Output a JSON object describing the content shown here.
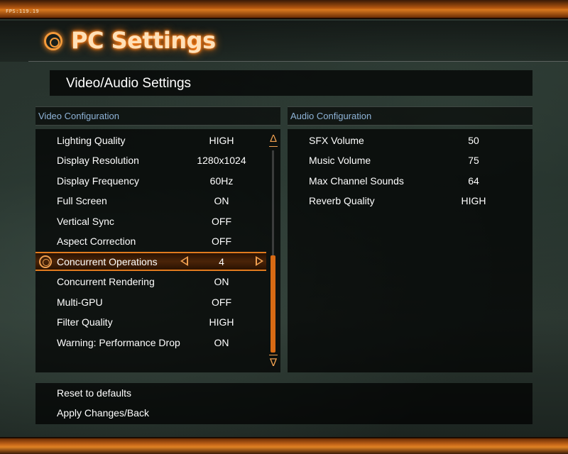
{
  "fps": "FPS:119.19",
  "app_title": "PC Settings",
  "panel_title": "Video/Audio Settings",
  "video": {
    "header": "Video Configuration",
    "rows": [
      {
        "label": "Lighting Quality",
        "value": "HIGH"
      },
      {
        "label": "Display Resolution",
        "value": "1280x1024"
      },
      {
        "label": "Display Frequency",
        "value": "60Hz"
      },
      {
        "label": "Full Screen",
        "value": "ON"
      },
      {
        "label": "Vertical Sync",
        "value": "OFF"
      },
      {
        "label": "Aspect Correction",
        "value": "OFF"
      },
      {
        "label": "Concurrent Operations",
        "value": "4"
      },
      {
        "label": "Concurrent Rendering",
        "value": "ON"
      },
      {
        "label": "Multi-GPU",
        "value": "OFF"
      },
      {
        "label": "Filter Quality",
        "value": "HIGH"
      },
      {
        "label": "Warning: Performance Drop",
        "value": "ON"
      }
    ],
    "selected_index": 6,
    "scroll_up_glyph": "Δ",
    "scroll_down_glyph": "∇"
  },
  "audio": {
    "header": "Audio Configuration",
    "rows": [
      {
        "label": "SFX Volume",
        "value": "50"
      },
      {
        "label": "Music Volume",
        "value": "75"
      },
      {
        "label": "Max Channel Sounds",
        "value": "64"
      },
      {
        "label": "Reverb Quality",
        "value": "HIGH"
      }
    ]
  },
  "footer": {
    "reset": "Reset to defaults",
    "apply": "Apply Changes/Back"
  },
  "colors": {
    "accent": "#e07a1e",
    "header_text": "#8fb4d8"
  }
}
